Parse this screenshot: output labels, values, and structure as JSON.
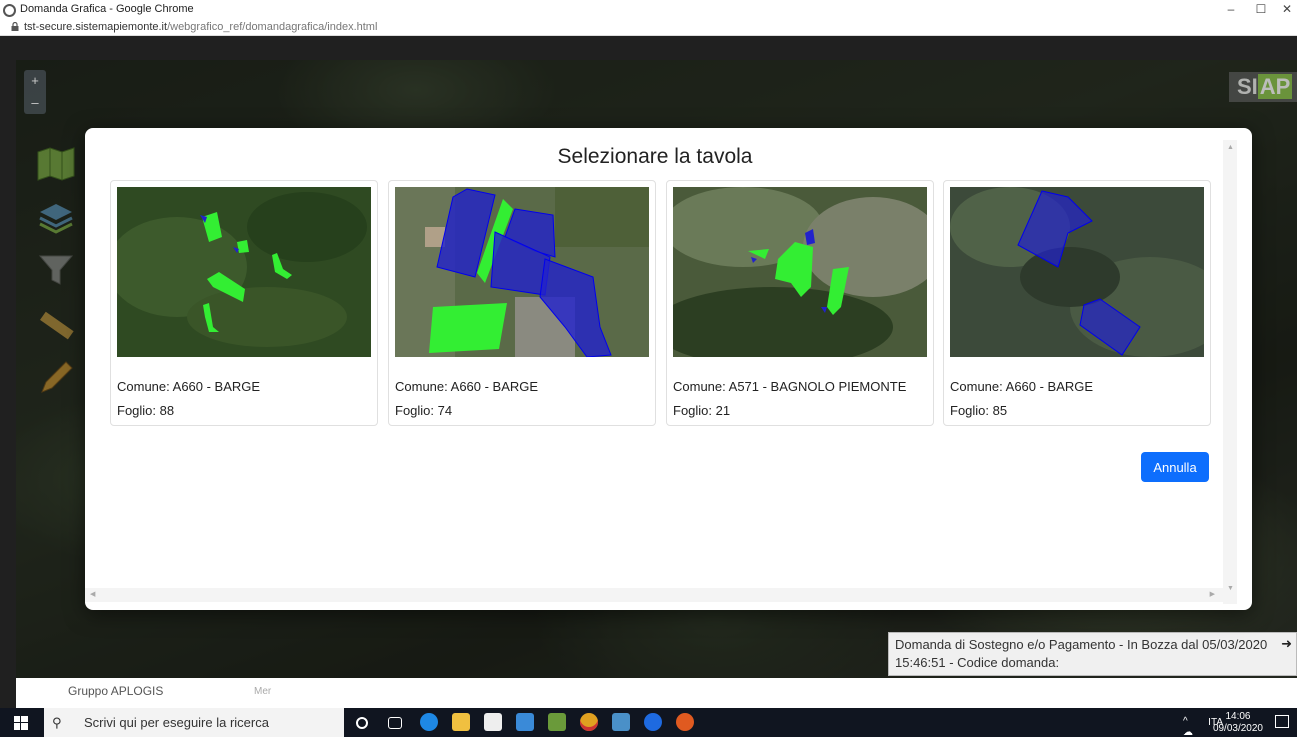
{
  "window": {
    "title": "Domanda Grafica - Google Chrome",
    "url_host": "tst-secure.sistemapiemonte.it",
    "url_path": "/webgrafico_ref/domandagrafica/index.html",
    "minimize": "–",
    "maximize": "☐",
    "close": "✕"
  },
  "map": {
    "zoom_in": "+",
    "zoom_out": "–",
    "logo_si": "SI",
    "logo_ap": "AP"
  },
  "modal": {
    "title": "Selezionare la tavola",
    "cards": [
      {
        "comune": "Comune: A660 - BARGE",
        "foglio": "Foglio: 88"
      },
      {
        "comune": "Comune: A660 - BARGE",
        "foglio": "Foglio: 74"
      },
      {
        "comune": "Comune: A571 - BAGNOLO PIEMONTE",
        "foglio": "Foglio: 21"
      },
      {
        "comune": "Comune: A660 - BARGE",
        "foglio": "Foglio: 85"
      }
    ],
    "cancel_label": "Annulla"
  },
  "status": {
    "text": "Domanda di Sostegno e/o Pagamento - In Bozza dal 05/03/2020 15:46:51 - Codice domanda:"
  },
  "bottom": {
    "group": "Gruppo APLOGIS",
    "mer": "Mer"
  },
  "taskbar": {
    "search_placeholder": "Scrivi qui per eseguire la ricerca",
    "language": "ITA",
    "time": "14:06",
    "date": "09/03/2020"
  },
  "colors": {
    "accent": "#0d6efd",
    "parcel_green": "#33ee33",
    "parcel_blue": "#2222cc"
  }
}
